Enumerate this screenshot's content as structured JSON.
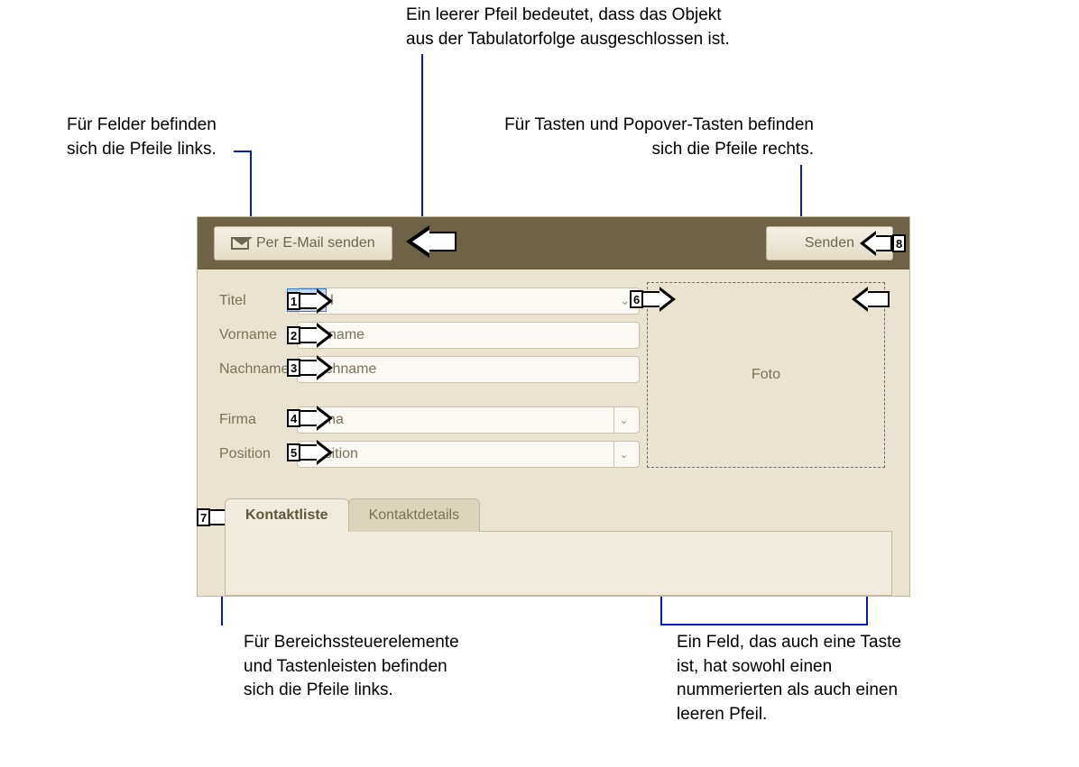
{
  "callouts": {
    "top_center": "Ein leerer Pfeil bedeutet, dass das Objekt\naus der Tabulatorfolge ausgeschlossen ist.",
    "left_top": "Für Felder befinden\nsich die Pfeile links.",
    "right_top": "Für Tasten und Popover-Tasten befinden\nsich die Pfeile rechts.",
    "bottom_left": "Für Bereichssteuerelemente\nund Tastenleisten befinden\nsich die Pfeile links.",
    "bottom_right": "Ein Feld, das auch eine Taste\nist, hat sowohl einen\nnummerierten als auch einen\nleeren Pfeil."
  },
  "toolbar": {
    "email_button": "Per E-Mail senden",
    "send_button": "Senden"
  },
  "form": {
    "rows": [
      {
        "label": "Titel",
        "placeholder": "Titel",
        "order": "1",
        "hasChevInline": true
      },
      {
        "label": "Vorname",
        "placeholder": "Vorname",
        "order": "2"
      },
      {
        "label": "Nachname",
        "placeholder": "Nachname",
        "order": "3"
      },
      {
        "label": "Firma",
        "placeholder": "Firma",
        "order": "4",
        "hasDropdown": true
      },
      {
        "label": "Position",
        "placeholder": "Position",
        "order": "5",
        "hasDropdown": true
      }
    ],
    "photo_label": "Foto",
    "photo_order": "6"
  },
  "tabs": {
    "active": "Kontaktliste",
    "inactive": "Kontaktdetails",
    "order": "7"
  },
  "send_order": "8"
}
